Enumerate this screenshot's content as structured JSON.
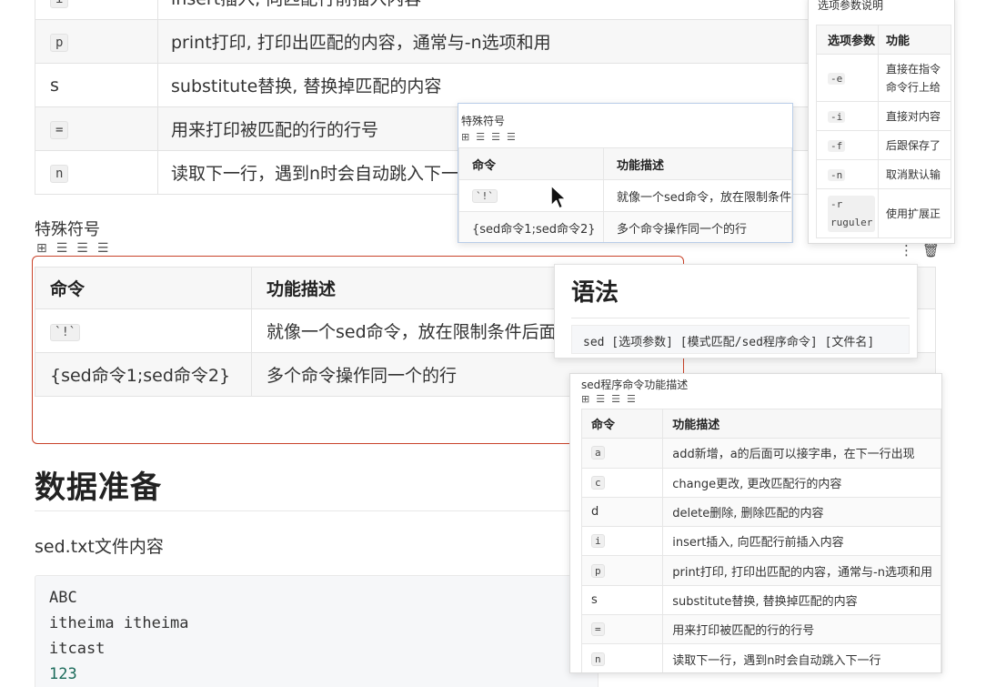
{
  "main_table": {
    "rows": [
      {
        "cmd": "i",
        "desc": "insert插入, 向匹配行前插入内容"
      },
      {
        "cmd": "p",
        "desc": "print打印, 打印出匹配的内容，通常与-n选项和用"
      },
      {
        "cmd": "s",
        "desc": "substitute替换, 替换掉匹配的内容"
      },
      {
        "cmd": "=",
        "desc": "用来打印被匹配的行的行号"
      },
      {
        "cmd": "n",
        "desc": "读取下一行，遇到n时会自动跳入下一行"
      }
    ]
  },
  "special_section": {
    "label": "特殊符号",
    "table": {
      "headers": [
        "命令",
        "功能描述"
      ],
      "rows": [
        {
          "cmd": "`!`",
          "desc": "就像一个sed命令，放在限制条件后面"
        },
        {
          "cmd": "{sed命令1;sed命令2}",
          "desc": "多个命令操作同一个的行"
        }
      ]
    }
  },
  "data_prep": {
    "heading": "数据准备",
    "file_label": "sed.txt文件内容",
    "code_lines": [
      "ABC",
      "itheima itheima",
      "itcast",
      "123"
    ]
  },
  "popup_special": {
    "caption": "特殊符号",
    "headers": [
      "命令",
      "功能描述"
    ],
    "rows": [
      {
        "cmd": "`!`",
        "desc": "就像一个sed命令，放在限制条件"
      },
      {
        "cmd": "{sed命令1;sed命令2}",
        "desc": "多个命令操作同一个的行"
      }
    ]
  },
  "popup_options": {
    "caption": "选项参数说明",
    "headers": [
      "选项参数",
      "功能"
    ],
    "rows": [
      {
        "opt": "-e",
        "desc": "直接在指令\n命令行上给"
      },
      {
        "opt": "-i",
        "desc": "直接对内容"
      },
      {
        "opt": "-f",
        "desc": "后跟保存了"
      },
      {
        "opt": "-n",
        "desc": "取消默认输"
      },
      {
        "opt": "-r\nruguler",
        "desc": "使用扩展正"
      }
    ]
  },
  "popup_syntax": {
    "title": "语法",
    "code": "sed [选项参数] [模式匹配/sed程序命令] [文件名]"
  },
  "popup_commands": {
    "caption": "sed程序命令功能描述",
    "headers": [
      "命令",
      "功能描述"
    ],
    "rows": [
      {
        "cmd": "a",
        "desc": "add新增，a的后面可以接字串，在下一行出现"
      },
      {
        "cmd": "c",
        "desc": "change更改, 更改匹配行的内容"
      },
      {
        "cmd": "d",
        "desc": "delete删除, 删除匹配的内容"
      },
      {
        "cmd": "i",
        "desc": "insert插入, 向匹配行前插入内容"
      },
      {
        "cmd": "p",
        "desc": "print打印, 打印出匹配的内容，通常与-n选项和用"
      },
      {
        "cmd": "s",
        "desc": "substitute替换, 替换掉匹配的内容"
      },
      {
        "cmd": "=",
        "desc": "用来打印被匹配的行的行号"
      },
      {
        "cmd": "n",
        "desc": "读取下一行，遇到n时会自动跳入下一行"
      }
    ]
  },
  "icons": {
    "table_tools": [
      "grid-icon",
      "align-left-icon",
      "align-center-icon",
      "align-right-icon"
    ],
    "row_tools": [
      "more-vertical-icon",
      "trash-icon"
    ],
    "cursor": "mouse-pointer-icon"
  },
  "colors": {
    "selection_border": "#c9432a",
    "popup_border": "#b9cde8",
    "number_green": "#1a6a5a"
  }
}
